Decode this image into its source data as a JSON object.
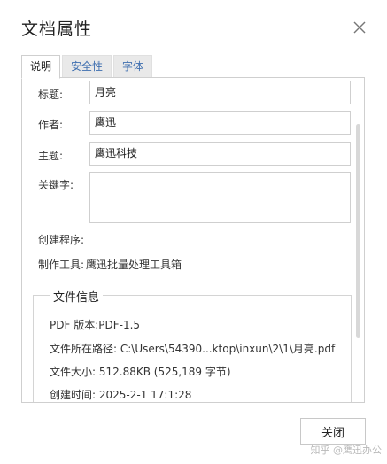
{
  "dialog": {
    "title": "文档属性",
    "close_icon": "close-icon"
  },
  "tabs": [
    {
      "label": "说明",
      "active": true
    },
    {
      "label": "安全性",
      "active": false
    },
    {
      "label": "字体",
      "active": false
    }
  ],
  "description": {
    "title_label": "标题:",
    "title_value": "月亮",
    "author_label": "作者:",
    "author_value": "鹰迅",
    "subject_label": "主题:",
    "subject_value": "鹰迅科技",
    "keywords_label": "关键字:",
    "keywords_value": "",
    "creator_label": "创建程序:",
    "creator_value": "",
    "producer_label": "制作工具:",
    "producer_value": "鹰迅批量处理工具箱"
  },
  "file_info": {
    "legend": "文件信息",
    "pdf_version": "PDF 版本:PDF-1.5",
    "path": "文件所在路径: C:\\Users\\54390...ktop\\inxun\\2\\1\\月亮.pdf",
    "size": "文件大小: 512.88KB (525,189 字节)",
    "created": "创建时间: 2025-2-1 17:1:28"
  },
  "footer": {
    "close_label": "关闭"
  },
  "watermark": "知乎 @鹰迅办公"
}
